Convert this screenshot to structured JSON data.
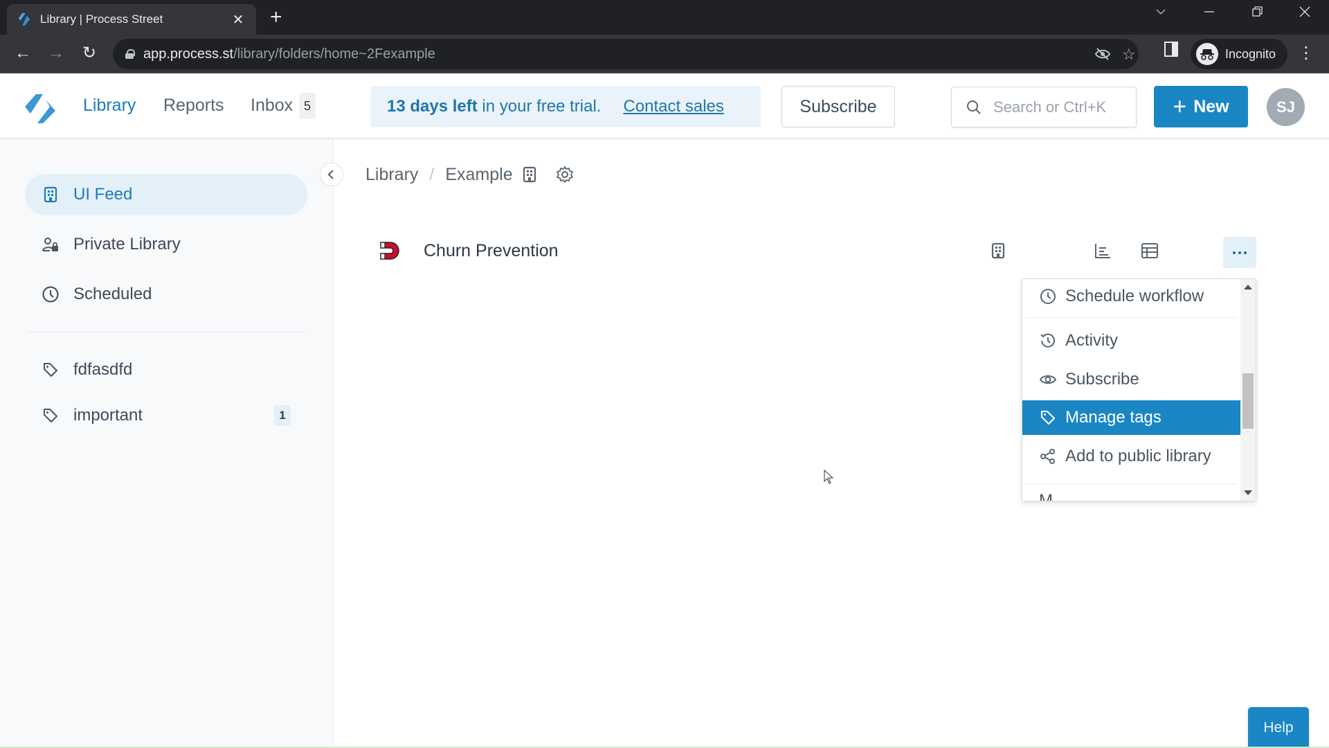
{
  "browser": {
    "tab_title": "Library | Process Street",
    "url_host": "app.process.st",
    "url_path": "/library/folders/home~2Fexample",
    "profile_label": "Incognito"
  },
  "header": {
    "nav": [
      {
        "label": "Library",
        "active": true
      },
      {
        "label": "Reports",
        "active": false
      },
      {
        "label": "Inbox",
        "active": false
      }
    ],
    "inbox_count": "5",
    "trial": {
      "bold": "13 days left",
      "text": " in your free trial.",
      "link": "Contact sales"
    },
    "subscribe_label": "Subscribe",
    "search_placeholder": "Search or Ctrl+K",
    "new_label": "New",
    "avatar_initials": "SJ",
    "brand_color": "#1a86c3"
  },
  "sidebar": {
    "items": [
      {
        "label": "UI Feed",
        "icon": "building-icon",
        "active": true
      },
      {
        "label": "Private Library",
        "icon": "user-lock-icon",
        "active": false
      },
      {
        "label": "Scheduled",
        "icon": "clock-icon",
        "active": false
      }
    ],
    "tags": [
      {
        "label": "fdfasdfd",
        "icon": "tag-icon",
        "count": null
      },
      {
        "label": "important",
        "icon": "tag-icon",
        "count": "1"
      }
    ]
  },
  "main": {
    "breadcrumb": [
      {
        "label": "Library"
      },
      {
        "label": "Example"
      }
    ],
    "breadcrumb_sep": "/",
    "rows": [
      {
        "title": "Churn Prevention",
        "icon": "magnet-icon"
      }
    ]
  },
  "menu": {
    "items": [
      {
        "label": "Schedule workflow",
        "icon": "clock-icon"
      },
      {
        "label": "Activity",
        "icon": "history-icon"
      },
      {
        "label": "Subscribe",
        "icon": "eye-icon"
      },
      {
        "label": "Manage tags",
        "icon": "tag-icon",
        "highlighted": true
      },
      {
        "label": "Add to public library",
        "icon": "share-icon"
      }
    ],
    "partial_item": "M..."
  },
  "help_label": "Help"
}
